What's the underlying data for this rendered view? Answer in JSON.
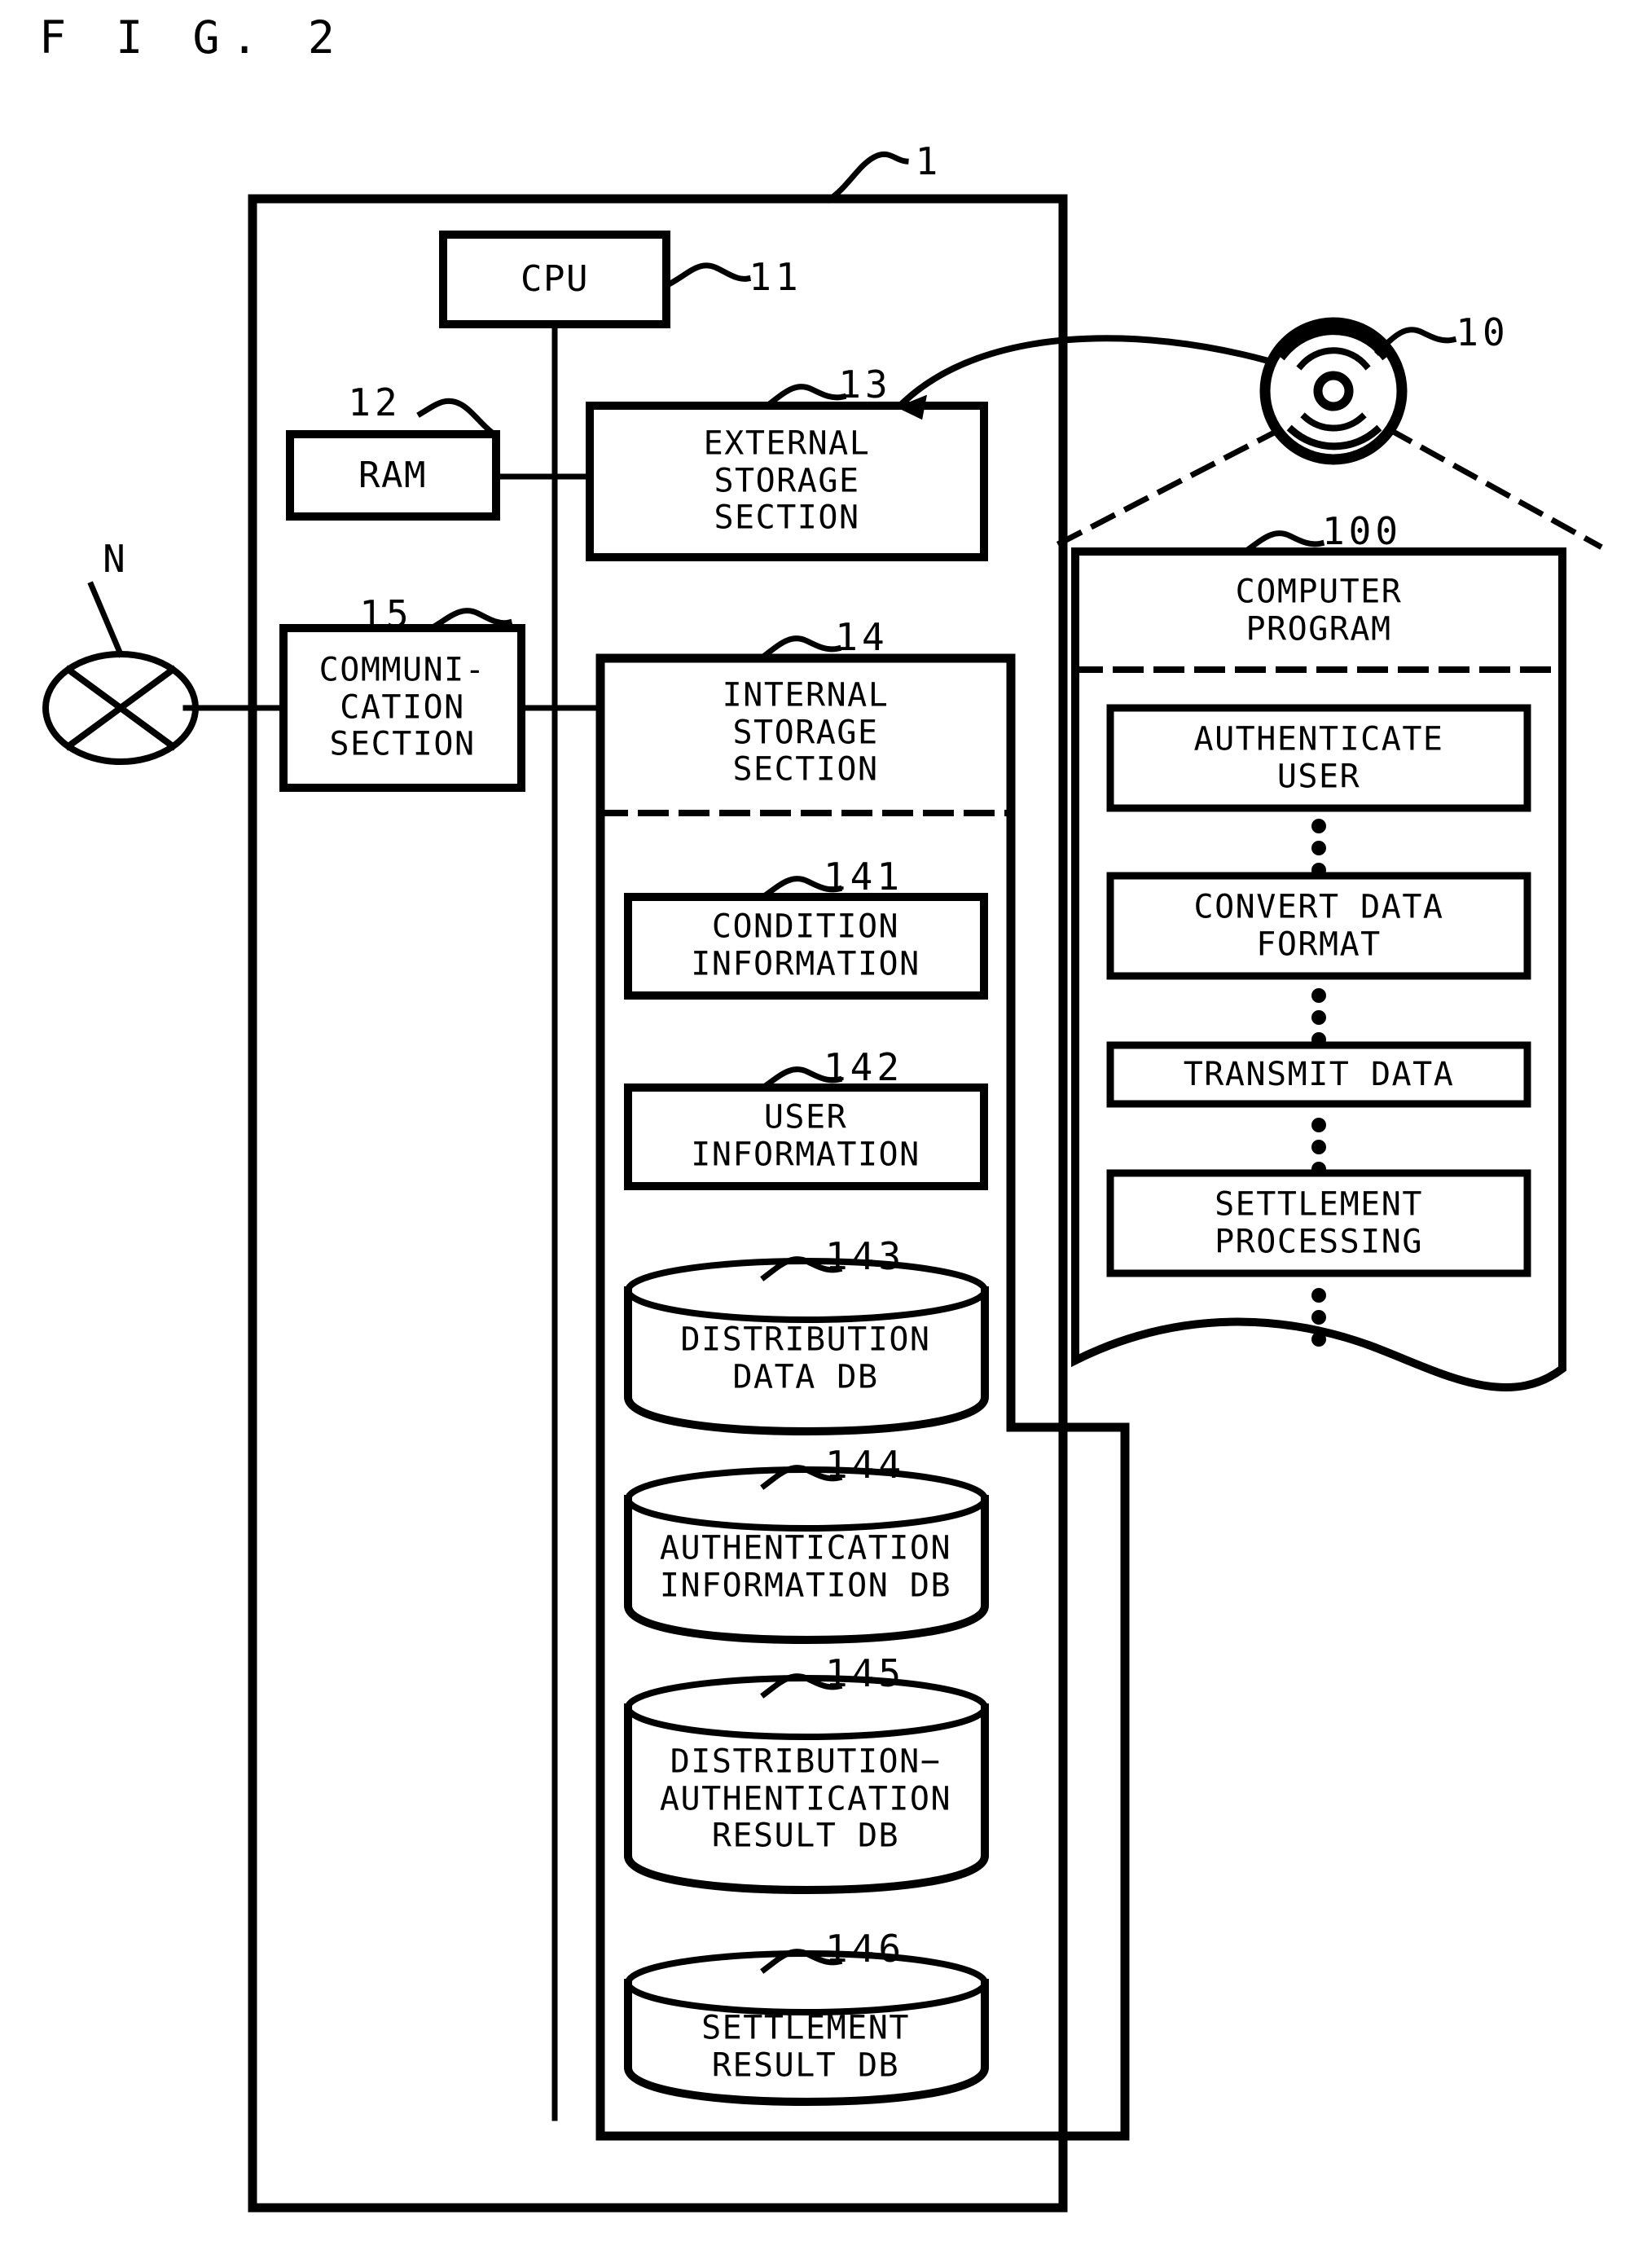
{
  "figure": {
    "title": "F I G. 2",
    "type": "patent-block-diagram"
  },
  "reference_numerals": {
    "system": "1",
    "cpu": "11",
    "ram": "12",
    "external_storage": "13",
    "internal_storage": "14",
    "communication": "15",
    "recording_medium": "10",
    "computer_program": "100",
    "condition_information": "141",
    "user_information": "142",
    "distribution_data_db": "143",
    "authentication_information_db": "144",
    "distribution_authentication_result_db": "145",
    "settlement_result_db": "146"
  },
  "network": {
    "label": "N",
    "symbol": "network-cloud-cross-ellipse"
  },
  "system": {
    "blocks": {
      "cpu": "CPU",
      "ram": "RAM",
      "external_storage": "EXTERNAL\nSTORAGE\nSECTION",
      "communication": "COMMUNI-\nCATION\nSECTION",
      "internal_storage_title": "INTERNAL\nSTORAGE\nSECTION"
    }
  },
  "internal_storage_items": [
    {
      "numeral": "141",
      "label": "CONDITION\nINFORMATION",
      "shape": "rect"
    },
    {
      "numeral": "142",
      "label": "USER\nINFORMATION",
      "shape": "rect"
    },
    {
      "numeral": "143",
      "label": "DISTRIBUTION\nDATA DB",
      "shape": "cylinder"
    },
    {
      "numeral": "144",
      "label": "AUTHENTICATION\nINFORMATION DB",
      "shape": "cylinder"
    },
    {
      "numeral": "145",
      "label": "DISTRIBUTION−\nAUTHENTICATION\nRESULT DB",
      "shape": "cylinder"
    },
    {
      "numeral": "146",
      "label": "SETTLEMENT\nRESULT DB",
      "shape": "cylinder"
    }
  ],
  "recording_medium": {
    "numeral": "10",
    "icon": "optical-disc-icon"
  },
  "computer_program": {
    "numeral": "100",
    "title": "COMPUTER\nPROGRAM",
    "steps": [
      "AUTHENTICATE\nUSER",
      "CONVERT DATA\nFORMAT",
      "TRANSMIT DATA",
      "SETTLEMENT\nPROCESSING"
    ],
    "ellipsis_glyph": "⋮"
  },
  "colors": {
    "ink": "#000000",
    "paper": "#ffffff"
  }
}
